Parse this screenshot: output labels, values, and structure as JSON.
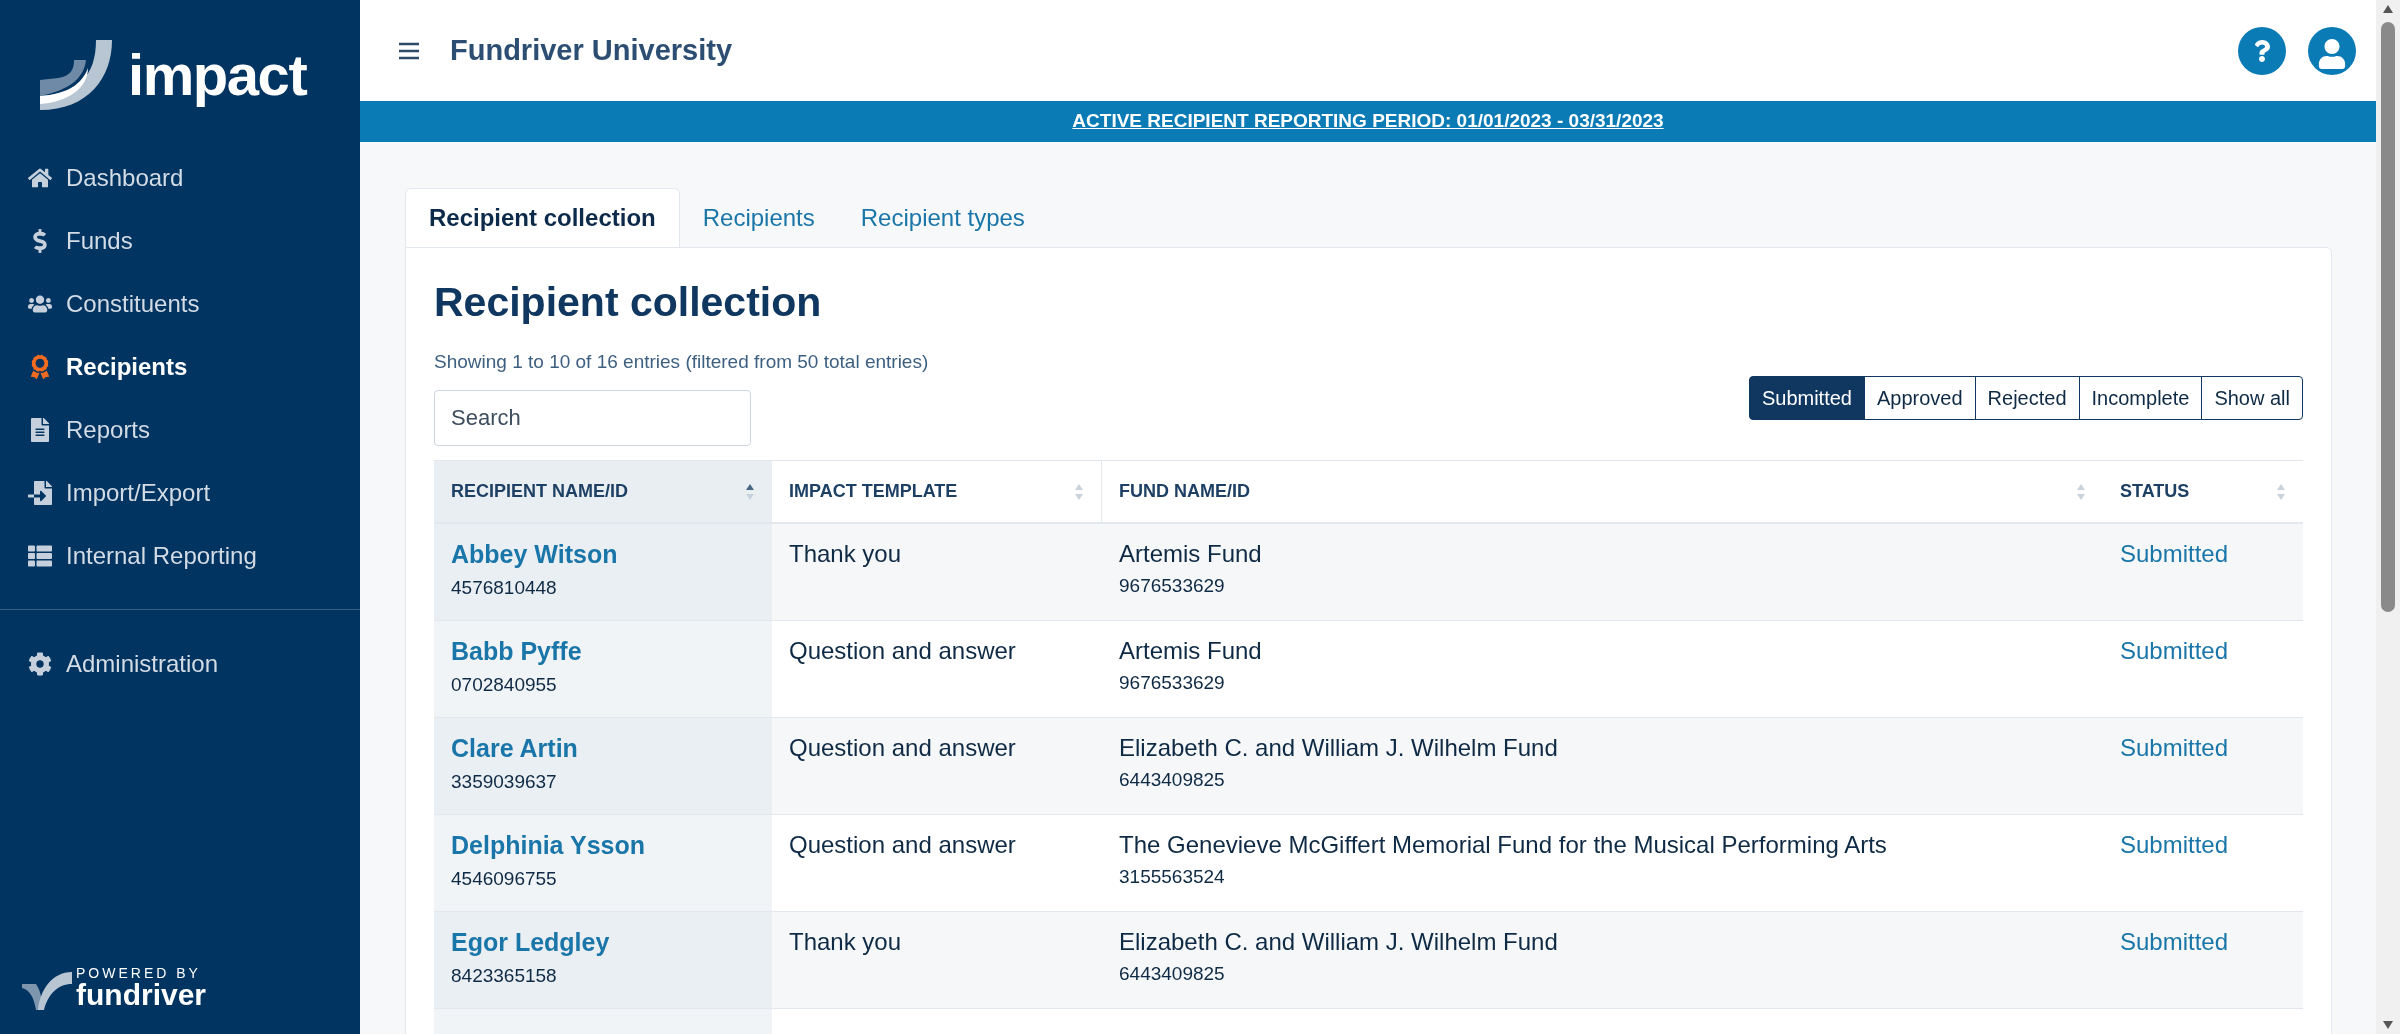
{
  "sidebar": {
    "logo_text": "impact",
    "items": [
      {
        "label": "Dashboard",
        "kind": "home",
        "selected": false
      },
      {
        "label": "Funds",
        "kind": "dollar",
        "selected": false
      },
      {
        "label": "Constituents",
        "kind": "users",
        "selected": false
      },
      {
        "label": "Recipients",
        "kind": "award",
        "selected": true
      },
      {
        "label": "Reports",
        "kind": "file",
        "selected": false
      },
      {
        "label": "Import/Export",
        "kind": "import",
        "selected": false
      },
      {
        "label": "Internal Reporting",
        "kind": "table",
        "selected": false
      }
    ],
    "admin_items": [
      {
        "label": "Administration",
        "kind": "gear",
        "selected": false
      }
    ],
    "powered_by": "POWERED BY",
    "brand": "fundriver"
  },
  "header": {
    "title": "Fundriver University"
  },
  "banner": "ACTIVE RECIPIENT REPORTING PERIOD: 01/01/2023 - 03/31/2023",
  "tabs": [
    {
      "label": "Recipient collection",
      "selected": true
    },
    {
      "label": "Recipients",
      "selected": false
    },
    {
      "label": "Recipient types",
      "selected": false
    }
  ],
  "page_title": "Recipient collection",
  "entries_info": "Showing 1 to 10 of 16 entries (filtered from 50 total entries)",
  "search": {
    "placeholder": "Search"
  },
  "filters": [
    {
      "label": "Submitted",
      "selected": true
    },
    {
      "label": "Approved",
      "selected": false
    },
    {
      "label": "Rejected",
      "selected": false
    },
    {
      "label": "Incomplete",
      "selected": false
    },
    {
      "label": "Show all",
      "selected": false
    }
  ],
  "table": {
    "columns": [
      {
        "label": "RECIPIENT NAME/ID",
        "sorted": true
      },
      {
        "label": "IMPACT TEMPLATE",
        "sorted": false
      },
      {
        "label": "FUND NAME/ID",
        "sorted": false
      },
      {
        "label": "STATUS",
        "sorted": false
      }
    ],
    "rows": [
      {
        "name": "Abbey Witson",
        "id": "4576810448",
        "template": "Thank you",
        "fund": "Artemis Fund",
        "fund_id": "9676533629",
        "status": "Submitted"
      },
      {
        "name": "Babb Pyffe",
        "id": "0702840955",
        "template": "Question and answer",
        "fund": "Artemis Fund",
        "fund_id": "9676533629",
        "status": "Submitted"
      },
      {
        "name": "Clare Artin",
        "id": "3359039637",
        "template": "Question and answer",
        "fund": "Elizabeth C. and William J. Wilhelm Fund",
        "fund_id": "6443409825",
        "status": "Submitted"
      },
      {
        "name": "Delphinia Ysson",
        "id": "4546096755",
        "template": "Question and answer",
        "fund": "The Genevieve McGiffert Memorial Fund for the Musical Performing Arts",
        "fund_id": "3155563524",
        "status": "Submitted"
      },
      {
        "name": "Egor Ledgley",
        "id": "8423365158",
        "template": "Thank you",
        "fund": "Elizabeth C. and William J. Wilhelm Fund",
        "fund_id": "6443409825",
        "status": "Submitted"
      }
    ]
  }
}
